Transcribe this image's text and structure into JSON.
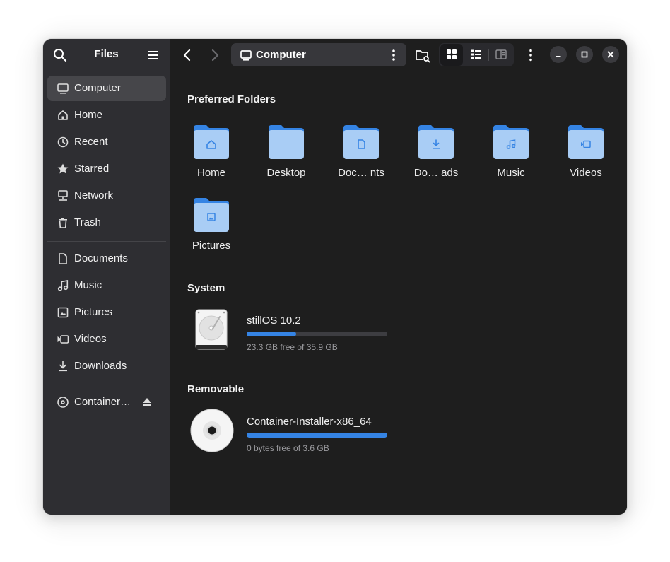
{
  "app": {
    "title": "Files"
  },
  "sidebar": {
    "items": [
      {
        "label": "Computer",
        "icon": "computer-icon"
      },
      {
        "label": "Home",
        "icon": "home-icon"
      },
      {
        "label": "Recent",
        "icon": "recent-icon"
      },
      {
        "label": "Starred",
        "icon": "star-icon"
      },
      {
        "label": "Network",
        "icon": "network-icon"
      },
      {
        "label": "Trash",
        "icon": "trash-icon"
      }
    ],
    "bookmarks": [
      {
        "label": "Documents",
        "icon": "document-icon"
      },
      {
        "label": "Music",
        "icon": "music-icon"
      },
      {
        "label": "Pictures",
        "icon": "pictures-icon"
      },
      {
        "label": "Videos",
        "icon": "videos-icon"
      },
      {
        "label": "Downloads",
        "icon": "download-icon"
      }
    ],
    "devices": [
      {
        "label": "Container…",
        "icon": "disc-icon"
      }
    ]
  },
  "header": {
    "location": "Computer"
  },
  "main": {
    "preferred_title": "Preferred Folders",
    "folders": [
      {
        "label": "Home",
        "icon": "home-folder-icon"
      },
      {
        "label": "Desktop",
        "icon": "desktop-folder-icon"
      },
      {
        "label": "Doc… nts",
        "icon": "documents-folder-icon"
      },
      {
        "label": "Do…  ads",
        "icon": "downloads-folder-icon"
      },
      {
        "label": "Music",
        "icon": "music-folder-icon"
      },
      {
        "label": "Videos",
        "icon": "videos-folder-icon"
      },
      {
        "label": "Pictures",
        "icon": "pictures-folder-icon"
      }
    ],
    "system_title": "System",
    "system_drive": {
      "name": "stillOS 10.2",
      "free": "23.3 GB free of 35.9 GB",
      "used_fraction": 0.35
    },
    "removable_title": "Removable",
    "removable_drive": {
      "name": "Container-Installer-x86_64",
      "free": "0 bytes free of 3.6 GB",
      "used_fraction": 1.0
    }
  },
  "colors": {
    "accent": "#3584e4",
    "folder": "#a9cdf5",
    "folder_tab": "#3584e4",
    "sidebar_bg": "#2e2e32",
    "content_bg": "#1e1e1e"
  }
}
